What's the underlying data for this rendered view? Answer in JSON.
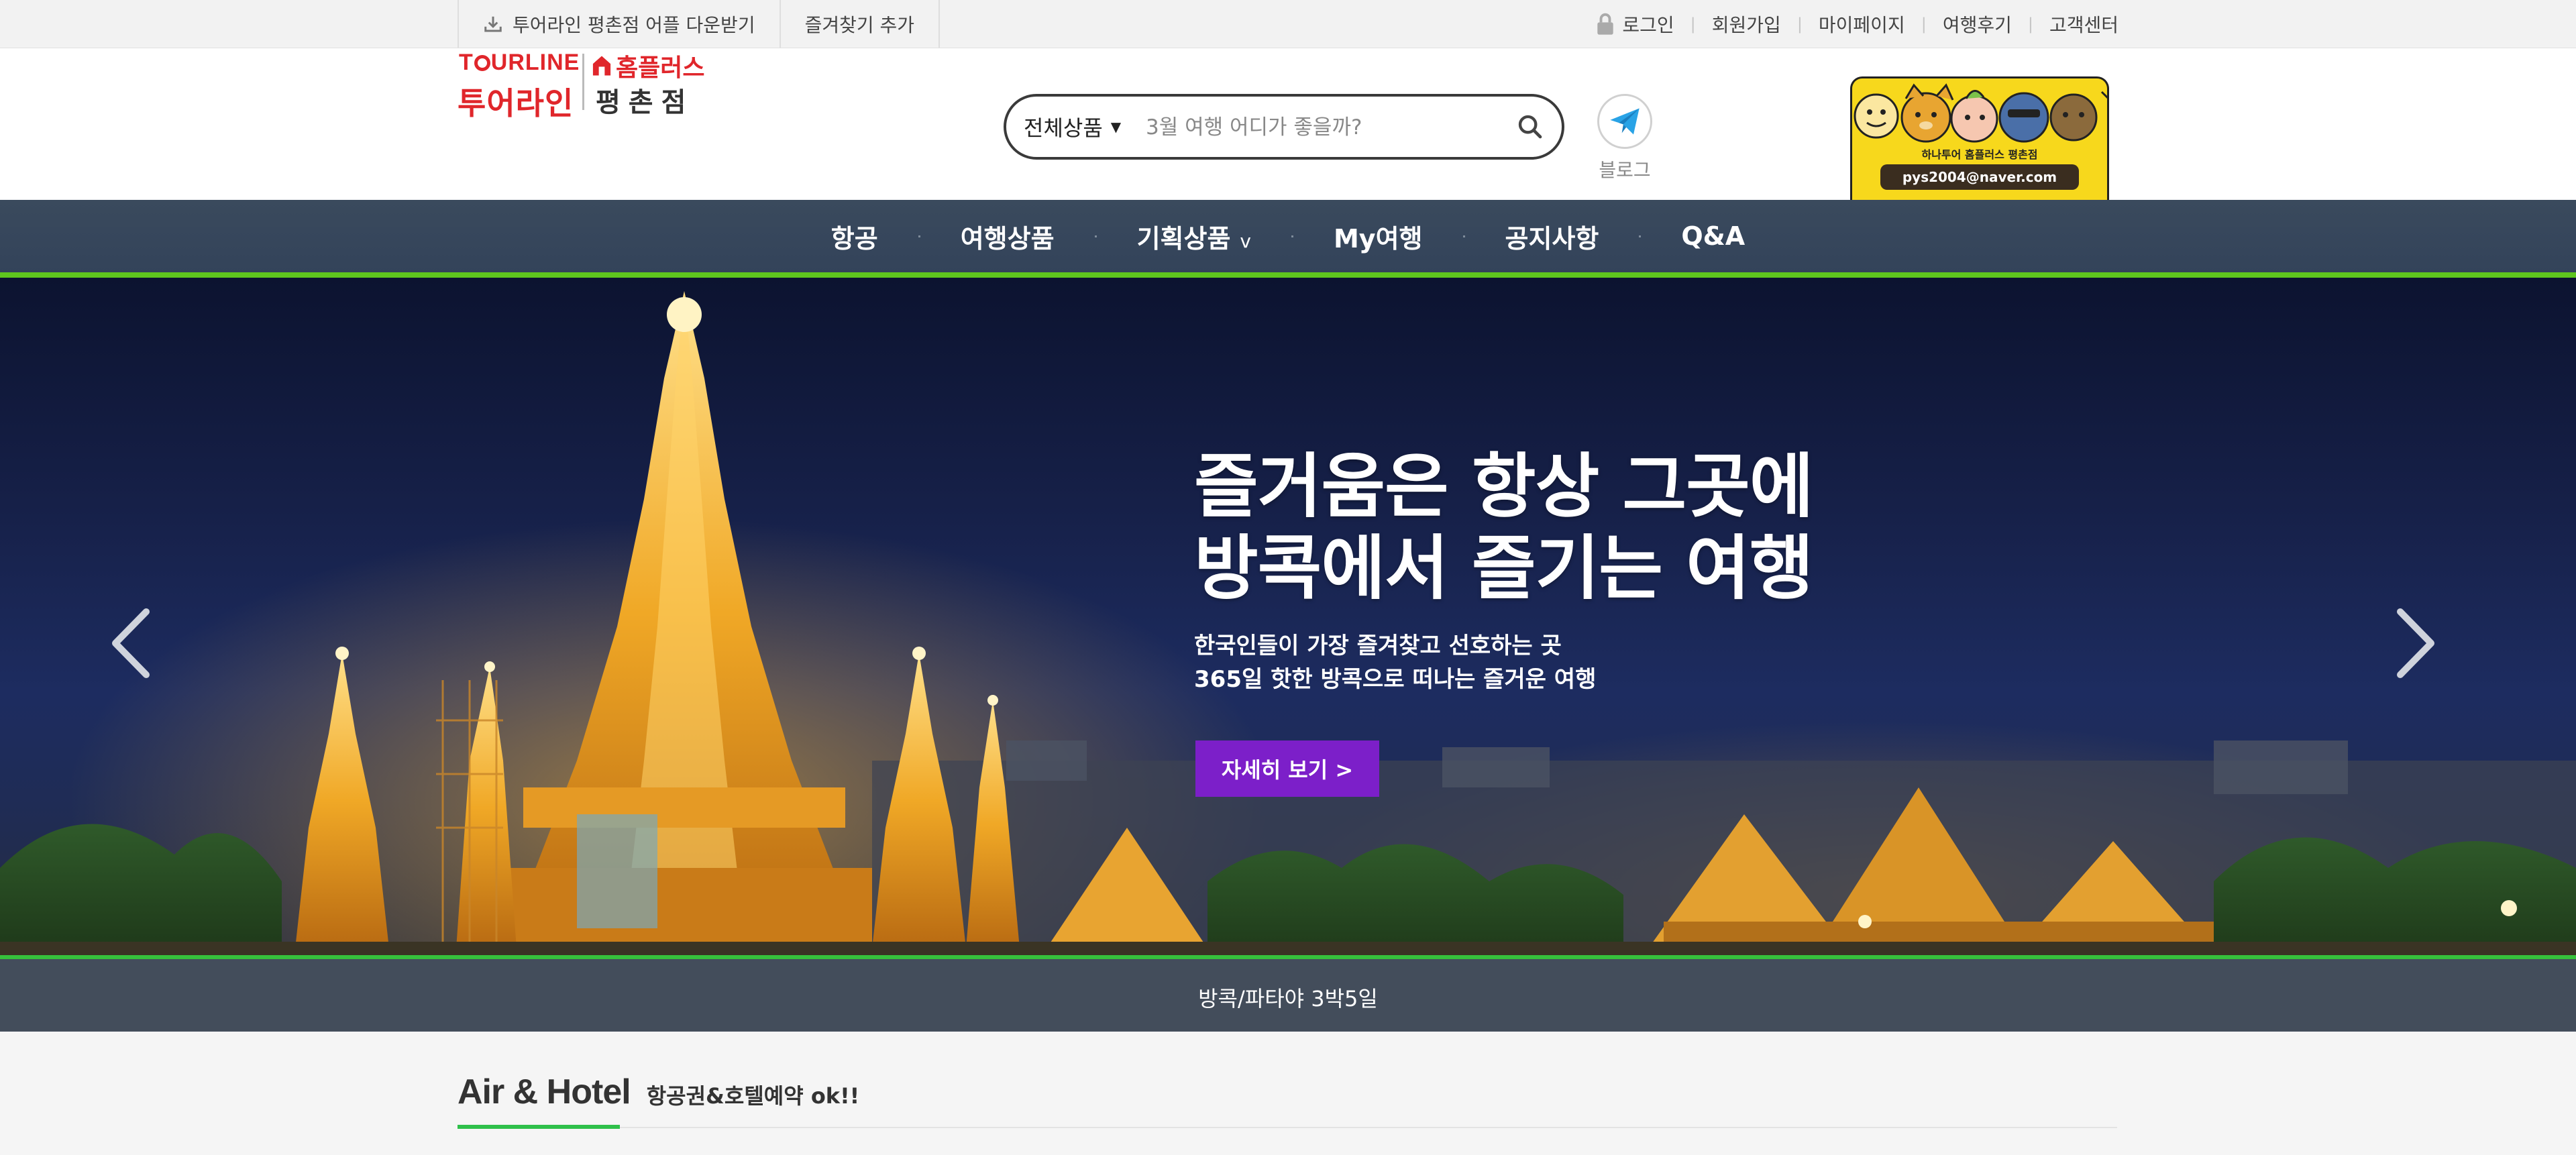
{
  "topbar": {
    "app_download": "투어라인 평촌점 어플 다운받기",
    "bookmark": "즐겨찾기 추가",
    "links": [
      "로그인",
      "회원가입",
      "마이페이지",
      "여행후기",
      "고객센터"
    ]
  },
  "logo": {
    "en_before": "T",
    "en_after": "URLINE",
    "ko": "투어라인",
    "brand": "홈플러스",
    "branch": "평촌점"
  },
  "search": {
    "category": "전체상품",
    "placeholder": "3월 여행 어디가 좋을까?"
  },
  "blog": {
    "label": "블로그"
  },
  "banner": {
    "title": "하나투어 홈플러스 평촌점",
    "email": "pys2004@naver.com"
  },
  "nav": {
    "items": [
      "항공",
      "여행상품",
      "기획상품",
      "My여행",
      "공지사항",
      "Q&A"
    ],
    "dropdown_marker": "v"
  },
  "hero": {
    "headline_line1": "즐거움은 항상 그곳에",
    "headline_line2": "방콕에서 즐기는 여행",
    "sub_line1": "한국인들이 가장 즐겨찾고 선호하는 곳",
    "sub_line2": "365일 핫한 방콕으로 떠나는 즐거운 여행",
    "cta": "자세히 보기 >",
    "caption": "방콕/파타야 3박5일"
  },
  "section": {
    "title_en": "Air & Hotel",
    "title_ko": "항공권&호텔예약 ok!!"
  },
  "colors": {
    "nav_bg": "#33435a",
    "nav_accent": "#5fc61e",
    "logo_red": "#e0262b",
    "cta_purple": "#7c1fc9",
    "section_accent": "#2fc04a"
  }
}
